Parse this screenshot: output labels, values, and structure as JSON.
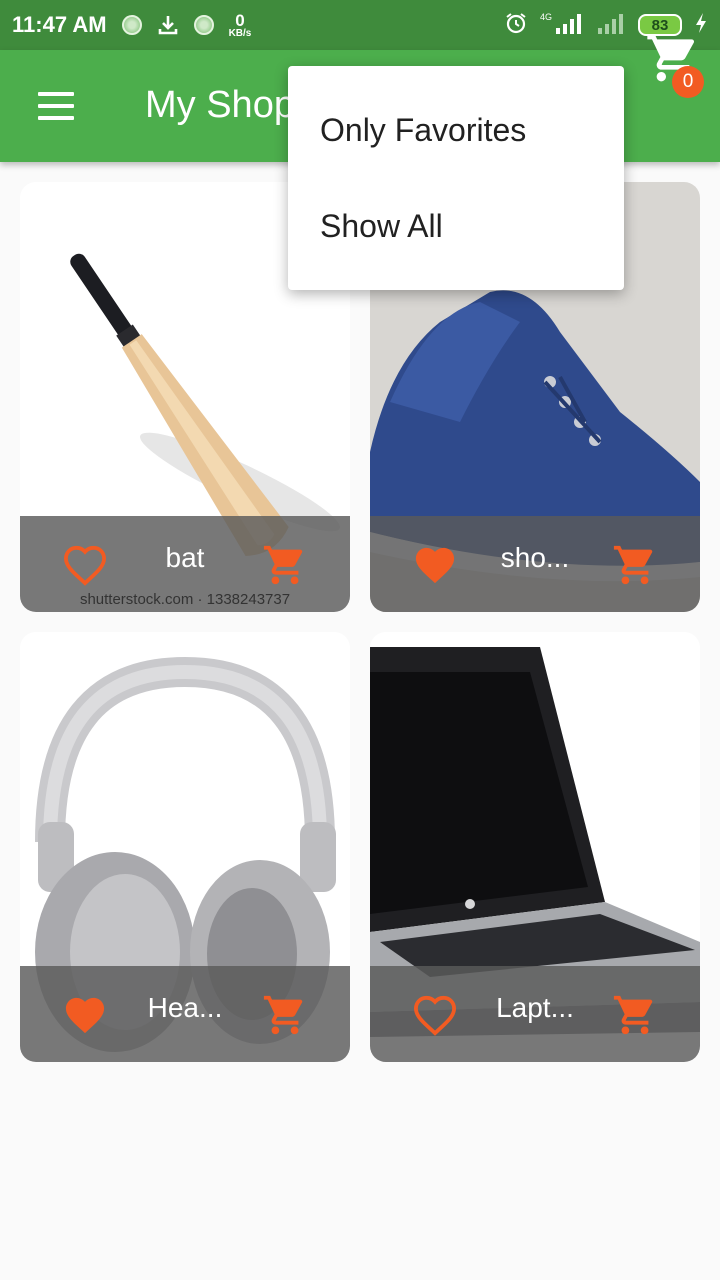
{
  "status_bar": {
    "time": "11:47 AM",
    "speed_value": "0",
    "speed_unit": "KB/s",
    "network_label": "4G",
    "battery": "83"
  },
  "app_bar": {
    "title": "My Shop",
    "cart_badge": "0"
  },
  "popup_menu": {
    "items": [
      "Only Favorites",
      "Show All"
    ]
  },
  "products": [
    {
      "name": "bat",
      "favorite": false,
      "watermark": "shutterstock.com · 1338243737"
    },
    {
      "name": "sho...",
      "favorite": true
    },
    {
      "name": "Hea...",
      "favorite": true
    },
    {
      "name": "Lapt...",
      "favorite": false
    }
  ],
  "colors": {
    "status_bar": "#3f8b3c",
    "app_bar": "#4cae4c",
    "accent": "#f25b22",
    "background": "#fafafa"
  },
  "icons": {
    "menu": "hamburger-icon",
    "cart": "shopping-cart-icon",
    "favorite": "heart-icon",
    "add_to_cart": "cart-add-icon"
  }
}
